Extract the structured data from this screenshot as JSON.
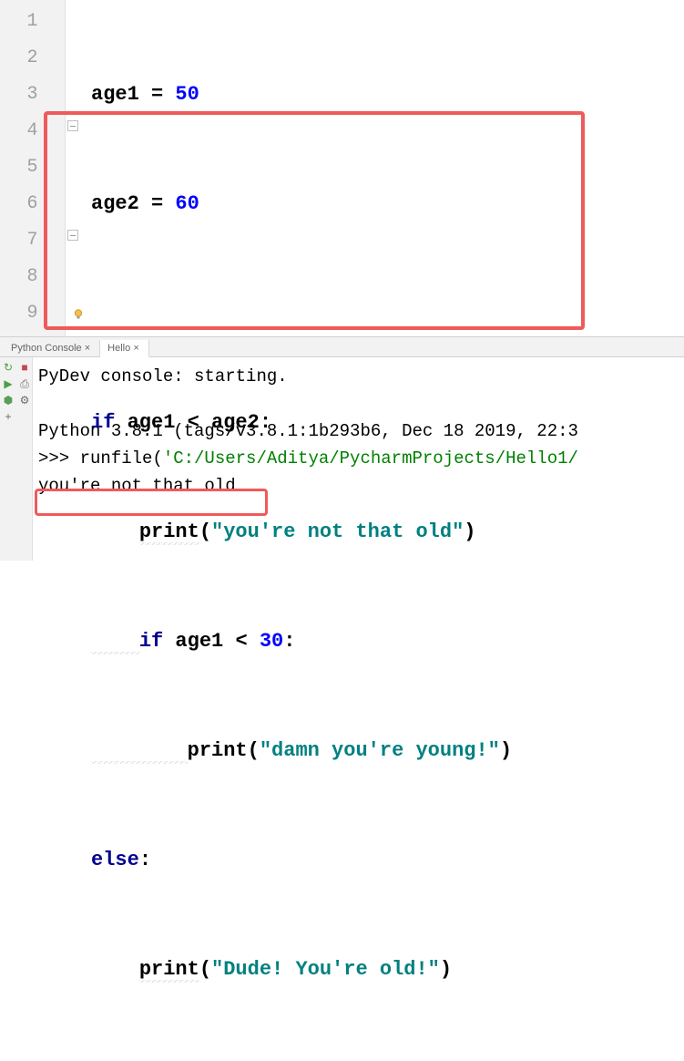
{
  "editor": {
    "line_numbers": [
      "1",
      "2",
      "3",
      "4",
      "5",
      "6",
      "7",
      "8",
      "9"
    ],
    "code": {
      "l1": {
        "id1": "age1",
        "op": " = ",
        "num": "50"
      },
      "l2": {
        "id1": "age2",
        "op": " = ",
        "num": "60"
      },
      "l4": {
        "kw": "if",
        "sp1": " ",
        "id1": "age1",
        "sp2": " ",
        "op": "<",
        "sp3": " ",
        "id2": "age2",
        "colon": ":"
      },
      "l5": {
        "indent": "    ",
        "fn": "print",
        "lp": "(",
        "str": "\"you're not that old\"",
        "rp": ")"
      },
      "l6": {
        "indent": "    ",
        "kw": "if",
        "sp1": " ",
        "id1": "age1",
        "sp2": " ",
        "op": "<",
        "sp3": " ",
        "num": "30",
        "colon": ":"
      },
      "l7": {
        "indent": "        ",
        "fn": "print",
        "lp": "(",
        "str": "\"damn you're young!\"",
        "rp": ")"
      },
      "l8": {
        "kw": "else",
        "colon": ":"
      },
      "l9": {
        "indent": "    ",
        "fn": "print",
        "lp": "(",
        "str": "\"Dude! You're old!\"",
        "rp": ")"
      }
    }
  },
  "tabs": {
    "python_console": "Python Console",
    "hello": "Hello",
    "close_glyph": "×"
  },
  "toolbar_icons": {
    "rerun": "↻",
    "stop": "■",
    "run": "▶",
    "print": "⎙",
    "bug": "⬢",
    "settings": "⚙",
    "add": "+"
  },
  "console": {
    "line1": "PyDev console: starting.",
    "blank": "",
    "line2": "Python 3.8.1 (tags/v3.8.1:1b293b6, Dec 18 2019, 22:3",
    "prompt": ">>> ",
    "runfile": "runfile(",
    "path": "'C:/Users/Aditya/PycharmProjects/Hello1/",
    "output": "you're not that old"
  }
}
